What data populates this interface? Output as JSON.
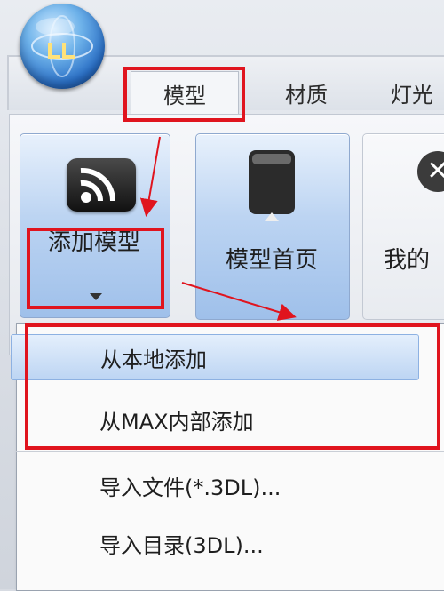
{
  "ribbon_tabs": {
    "models": "模型",
    "materials": "材质",
    "lights": "灯光"
  },
  "buttons": {
    "add_model": "添加模型",
    "model_home": "模型首页",
    "mine": "我的"
  },
  "dropdown_menu": {
    "items": [
      "从本地添加",
      "从MAX内部添加",
      "导入文件(*.3DL)...",
      "导入目录(3DL)..."
    ]
  },
  "colors": {
    "highlight": "#e0141e",
    "accent": "#9fc0ea"
  },
  "icons": {
    "app_logo": "app-orb-icon",
    "add_model": "rss-icon",
    "model_home": "hard-drive-icon",
    "mine": "close-circle-icon"
  }
}
